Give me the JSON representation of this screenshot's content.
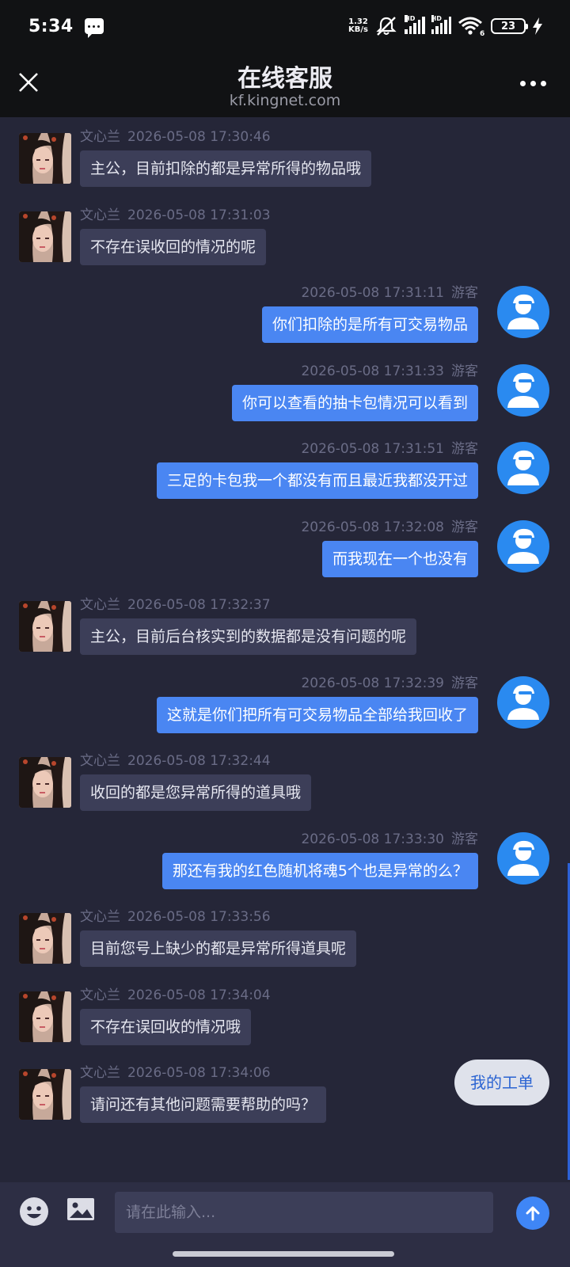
{
  "status_bar": {
    "time": "5:34",
    "net_speed_value": "1.32",
    "net_speed_unit": "KB/s",
    "signal1_label": "HD",
    "signal2_label": "HD",
    "wifi_label": "6",
    "battery": "23"
  },
  "header": {
    "title": "在线客服",
    "domain": "kf.kingnet.com"
  },
  "messages": [
    {
      "side": "agent",
      "name": "文心兰",
      "time": "2026-05-08 17:30:46",
      "text": "主公，目前扣除的都是异常所得的物品哦"
    },
    {
      "side": "agent",
      "name": "文心兰",
      "time": "2026-05-08 17:31:03",
      "text": "不存在误收回的情况的呢"
    },
    {
      "side": "user",
      "name": "游客",
      "time": "2026-05-08 17:31:11",
      "text": "你们扣除的是所有可交易物品"
    },
    {
      "side": "user",
      "name": "游客",
      "time": "2026-05-08 17:31:33",
      "text": "你可以查看的抽卡包情况可以看到"
    },
    {
      "side": "user",
      "name": "游客",
      "time": "2026-05-08 17:31:51",
      "text": "三足的卡包我一个都没有而且最近我都没开过"
    },
    {
      "side": "user",
      "name": "游客",
      "time": "2026-05-08 17:32:08",
      "text": "而我现在一个也没有"
    },
    {
      "side": "agent",
      "name": "文心兰",
      "time": "2026-05-08 17:32:37",
      "text": "主公，目前后台核实到的数据都是没有问题的呢"
    },
    {
      "side": "user",
      "name": "游客",
      "time": "2026-05-08 17:32:39",
      "text": "这就是你们把所有可交易物品全部给我回收了"
    },
    {
      "side": "agent",
      "name": "文心兰",
      "time": "2026-05-08 17:32:44",
      "text": "收回的都是您异常所得的道具哦"
    },
    {
      "side": "user",
      "name": "游客",
      "time": "2026-05-08 17:33:30",
      "text": "那还有我的红色随机将魂5个也是异常的么？"
    },
    {
      "side": "agent",
      "name": "文心兰",
      "time": "2026-05-08 17:33:56",
      "text": "目前您号上缺少的都是异常所得道具呢"
    },
    {
      "side": "agent",
      "name": "文心兰",
      "time": "2026-05-08 17:34:04",
      "text": "不存在误回收的情况哦"
    },
    {
      "side": "agent",
      "name": "文心兰",
      "time": "2026-05-08 17:34:06",
      "text": "请问还有其他问题需要帮助的吗？"
    }
  ],
  "work_order_button": "我的工单",
  "input": {
    "placeholder": "请在此输入..."
  },
  "colors": {
    "background": "#252638",
    "agent_bubble": "#3c3e58",
    "user_bubble": "#4a86f2",
    "accent": "#3f86f6"
  }
}
